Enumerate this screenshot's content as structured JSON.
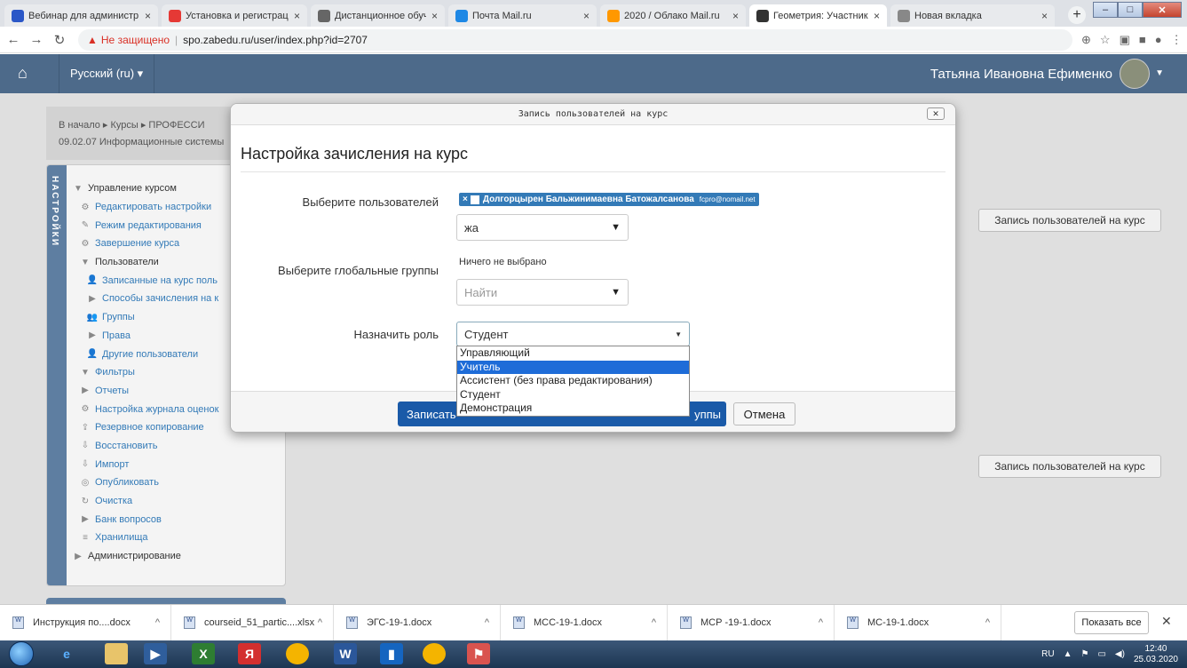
{
  "browser": {
    "tabs": [
      {
        "title": "Вебинар для администр",
        "color": "#2b57c7",
        "icon": "dots-icon"
      },
      {
        "title": "Установка и регистрация",
        "color": "#e53935",
        "icon": "z-logo-icon"
      },
      {
        "title": "Дистанционное обучени",
        "color": "#666666",
        "icon": "globe-icon"
      },
      {
        "title": "Почта Mail.ru",
        "color": "#1e88e5",
        "icon": "mail-icon"
      },
      {
        "title": "2020 / Облако Mail.ru",
        "color": "#ff9800",
        "icon": "cloud-icon"
      },
      {
        "title": "Геометрия: Участники",
        "color": "#333333",
        "icon": "moodle-icon"
      },
      {
        "title": "Новая вкладка",
        "color": "#888888",
        "icon": "newtab-icon"
      }
    ],
    "not_secure": "Не защищено",
    "url": "spo.zabedu.ru/user/index.php?id=2707"
  },
  "navbar": {
    "language": "Русский (ru) ▾",
    "user_name": "Татьяна Ивановна Ефименко"
  },
  "breadcrumb": {
    "line1": "В начало ▸ Курсы ▸ ПРОФЕССИ",
    "line2": "09.02.07 Информационные системы"
  },
  "settings": {
    "tab_label": "НАСТРОЙКИ",
    "items": [
      {
        "label": "Управление курсом",
        "icon": "▼",
        "dark": true,
        "indent": 0
      },
      {
        "label": "Редактировать настройки",
        "icon": "⚙",
        "dark": false,
        "indent": 1
      },
      {
        "label": "Режим редактирования",
        "icon": "✎",
        "dark": false,
        "indent": 1
      },
      {
        "label": "Завершение курса",
        "icon": "⚙",
        "dark": false,
        "indent": 1
      },
      {
        "label": "Пользователи",
        "icon": "▼",
        "dark": true,
        "indent": 1
      },
      {
        "label": "Записанные на курс поль",
        "icon": "👤",
        "dark": false,
        "indent": 2
      },
      {
        "label": "Способы зачисления на к",
        "icon": "▶",
        "dark": false,
        "indent": 2
      },
      {
        "label": "Группы",
        "icon": "👥",
        "dark": false,
        "indent": 2
      },
      {
        "label": "Права",
        "icon": "▶",
        "dark": false,
        "indent": 2
      },
      {
        "label": "Другие пользователи",
        "icon": "👤",
        "dark": false,
        "indent": 2
      },
      {
        "label": "Фильтры",
        "icon": "▼",
        "dark": false,
        "indent": 1
      },
      {
        "label": "Отчеты",
        "icon": "▶",
        "dark": false,
        "indent": 1
      },
      {
        "label": "Настройка журнала оценок",
        "icon": "⚙",
        "dark": false,
        "indent": 1
      },
      {
        "label": "Резервное копирование",
        "icon": "⇪",
        "dark": false,
        "indent": 1
      },
      {
        "label": "Восстановить",
        "icon": "⇩",
        "dark": false,
        "indent": 1
      },
      {
        "label": "Импорт",
        "icon": "⇩",
        "dark": false,
        "indent": 1
      },
      {
        "label": "Опубликовать",
        "icon": "◎",
        "dark": false,
        "indent": 1
      },
      {
        "label": "Очистка",
        "icon": "↻",
        "dark": false,
        "indent": 1
      },
      {
        "label": "Банк вопросов",
        "icon": "▶",
        "dark": false,
        "indent": 1
      },
      {
        "label": "Хранилища",
        "icon": "≡",
        "dark": false,
        "indent": 1
      },
      {
        "label": "Администрирование",
        "icon": "▶",
        "dark": true,
        "indent": 0
      }
    ]
  },
  "side_buttons": {
    "enrol_top": "Запись пользователей на курс",
    "enrol_bottom": "Запись пользователей на курс"
  },
  "modal": {
    "header": "Запись пользователей на курс",
    "close": "✕",
    "title": "Настройка зачисления на курс",
    "label_users": "Выберите пользователей",
    "selected_user": "Долгорцырен Бальжинимаевна Батожалсанова",
    "selected_email": "fcpro@nomail.net",
    "user_search_value": "жа",
    "label_groups": "Выберите глобальные группы",
    "groups_none": "Ничего не выбрано",
    "groups_placeholder": "Найти",
    "label_role": "Назначить роль",
    "role_value": "Студент",
    "role_options": [
      "Управляющий",
      "Учитель",
      "Ассистент (без права редактирования)",
      "Студент",
      "Демонстрация"
    ],
    "role_highlighted_index": 1,
    "submit_left": "Записать",
    "submit_right": "уппы",
    "cancel": "Отмена"
  },
  "downloads": {
    "files": [
      {
        "name": "Инструкция по....docx",
        "width": 193
      },
      {
        "name": "courseid_51_partic....xlsx",
        "width": 183
      },
      {
        "name": "ЭГС-19-1.docx",
        "width": 188
      },
      {
        "name": "МСС-19-1.docx",
        "width": 188
      },
      {
        "name": "МСР -19-1.docx",
        "width": 188
      },
      {
        "name": "МС-19-1.docx",
        "width": 188
      }
    ],
    "show_all": "Показать все"
  },
  "taskbar": {
    "lang": "RU",
    "time": "12:40",
    "date": "25.03.2020"
  }
}
